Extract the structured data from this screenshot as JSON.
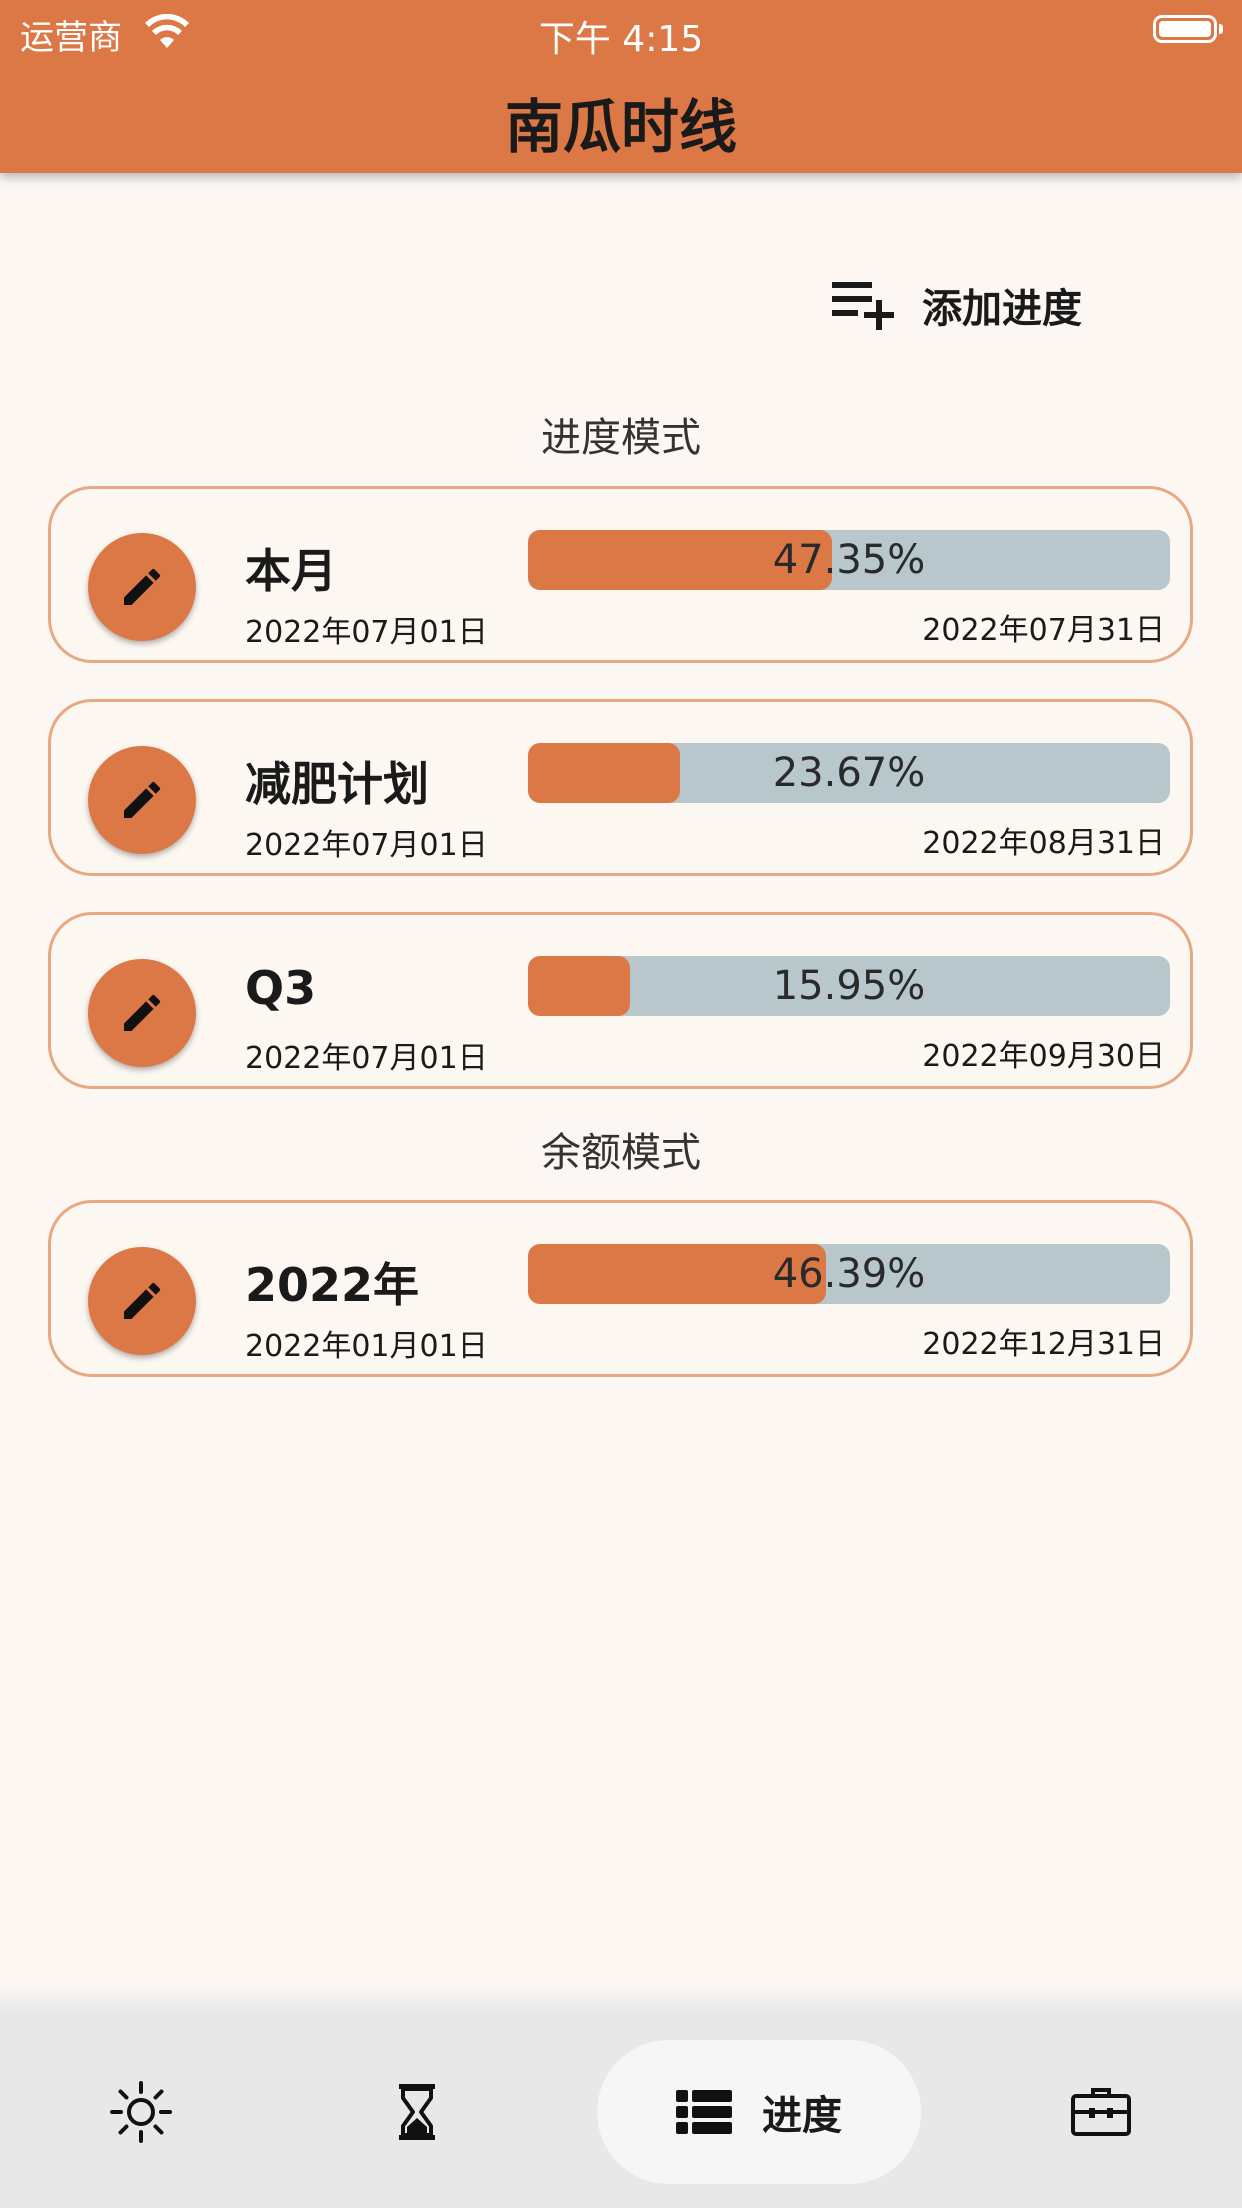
{
  "status": {
    "carrier": "运营商",
    "time": "下午 4:15"
  },
  "app": {
    "title": "南瓜时线"
  },
  "actions": {
    "add_label": "添加进度"
  },
  "sections": {
    "progress_mode": "进度模式",
    "balance_mode": "余额模式"
  },
  "progress_items": [
    {
      "name": "本月",
      "start": "2022年07月01日",
      "end": "2022年07月31日",
      "percent_label": "47.35%",
      "fraction": 0.4735
    },
    {
      "name": "减肥计划",
      "start": "2022年07月01日",
      "end": "2022年08月31日",
      "percent_label": "23.67%",
      "fraction": 0.2367
    },
    {
      "name": "Q3",
      "start": "2022年07月01日",
      "end": "2022年09月30日",
      "percent_label": "15.95%",
      "fraction": 0.1595
    }
  ],
  "balance_items": [
    {
      "name": "2022年",
      "start": "2022年01月01日",
      "end": "2022年12月31日",
      "percent_label": "46.39%",
      "fraction": 0.4639
    }
  ],
  "nav": {
    "active_label": "进度"
  },
  "colors": {
    "accent": "#dc7746",
    "bar_track": "#b8c7cc",
    "card_border": "#e6a981",
    "background": "#fcf7f3"
  }
}
